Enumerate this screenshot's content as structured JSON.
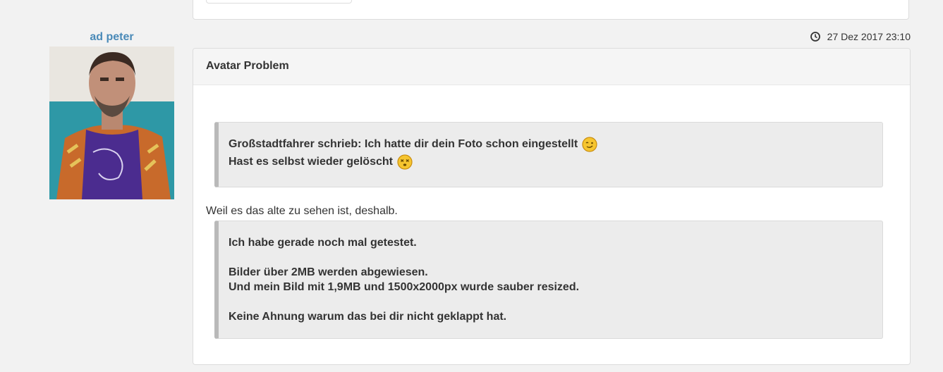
{
  "user": {
    "name": "ad peter"
  },
  "post": {
    "date": "27 Dez 2017 23:10",
    "title": "Avatar Problem",
    "quote1": {
      "line1": "Großstadtfahrer schrieb: Ich hatte dir dein Foto schon eingestellt",
      "line2": "Hast es selbst wieder gelöscht"
    },
    "body_text": "Weil es das alte zu sehen ist, deshalb.",
    "quote2": {
      "line1": "Ich habe gerade noch mal getestet.",
      "line2": "Bilder über 2MB werden abgewiesen.",
      "line3": "Und mein Bild mit 1,9MB und 1500x2000px wurde sauber resized.",
      "line4": "Keine Ahnung warum das bei dir nicht geklappt hat."
    }
  },
  "icons": {
    "date": "clock-icon",
    "smiley1": "winking-smiley-icon",
    "smiley2": "dizzy-smiley-icon"
  },
  "colors": {
    "username": "#4a8ab8",
    "quote_bg": "#ececec",
    "quote_border": "#b9b9b9"
  }
}
